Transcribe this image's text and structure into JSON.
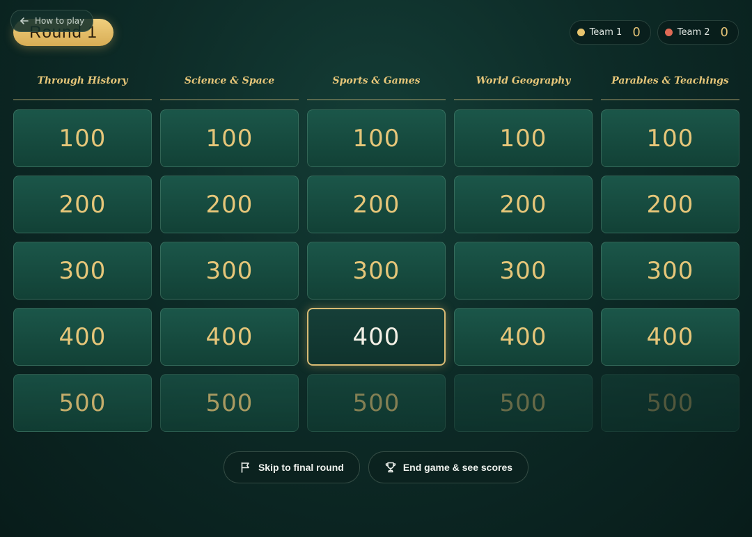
{
  "header": {
    "round_label": "Round 1",
    "how_to_play": "How to play"
  },
  "teams": [
    {
      "name": "Team 1",
      "score": "0",
      "color": "#e7c46e"
    },
    {
      "name": "Team 2",
      "score": "0",
      "color": "#e06a55"
    }
  ],
  "board": {
    "categories": [
      "Through History",
      "Science & Space",
      "Sports & Games",
      "World Geography",
      "Parables & Teachings"
    ],
    "values": [
      "100",
      "200",
      "300",
      "400",
      "500"
    ],
    "selected": {
      "category_index": 2,
      "value": "400"
    }
  },
  "actions": {
    "skip_label": "Skip to final round",
    "end_label": "End game & see scores"
  },
  "icons": {
    "back": "arrow-left-icon",
    "skip": "flag-icon",
    "end": "trophy-icon"
  },
  "colors": {
    "accent_gold": "#e6c679",
    "tile_green": "#1b5649",
    "background": "#0d2b27"
  }
}
